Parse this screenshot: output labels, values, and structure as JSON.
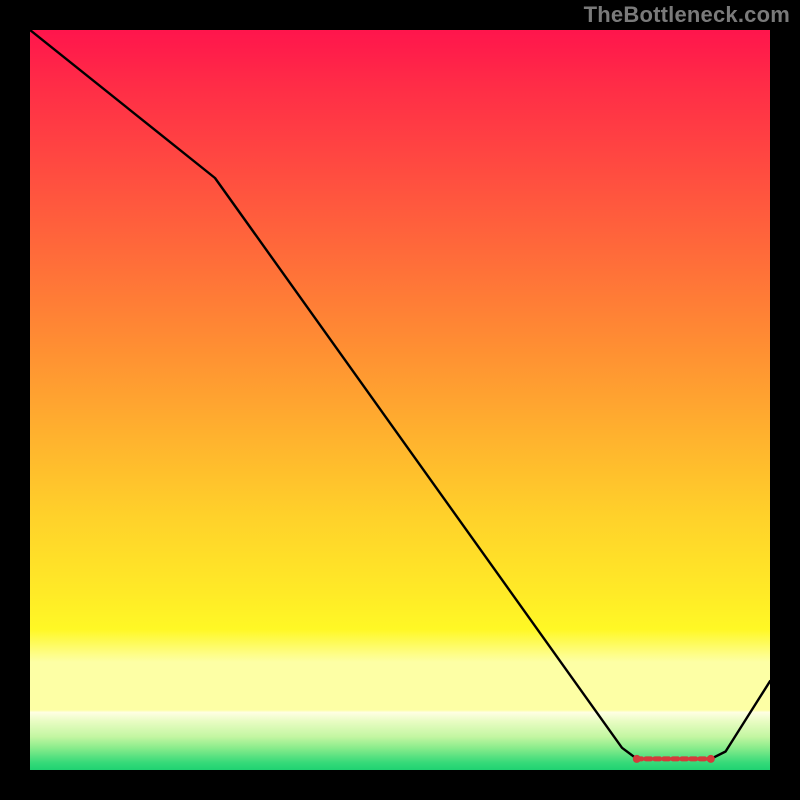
{
  "watermark": "TheBottleneck.com",
  "chart_data": {
    "type": "line",
    "title": "",
    "xlabel": "",
    "ylabel": "",
    "xlim": [
      0,
      100
    ],
    "ylim": [
      0,
      100
    ],
    "series": [
      {
        "name": "bottleneck-curve",
        "x": [
          0,
          25,
          80,
          82,
          92,
          94,
          100
        ],
        "values": [
          100,
          80,
          3,
          1.5,
          1.5,
          2.5,
          12
        ]
      }
    ],
    "optimal_zone": {
      "name": "sweet-spot-markers",
      "x": [
        82,
        84,
        86,
        88,
        90,
        92
      ],
      "values": [
        1.5,
        1.5,
        1.5,
        1.5,
        1.5,
        1.5
      ]
    },
    "gradient_stops": [
      {
        "pos": 0.0,
        "color": "#ff154c"
      },
      {
        "pos": 0.07,
        "color": "#ff2b47"
      },
      {
        "pos": 0.18,
        "color": "#ff4941"
      },
      {
        "pos": 0.3,
        "color": "#ff6a3a"
      },
      {
        "pos": 0.42,
        "color": "#ff8c33"
      },
      {
        "pos": 0.55,
        "color": "#ffb22e"
      },
      {
        "pos": 0.66,
        "color": "#ffd22a"
      },
      {
        "pos": 0.76,
        "color": "#ffea27"
      },
      {
        "pos": 0.81,
        "color": "#fff825"
      },
      {
        "pos": 0.855,
        "color": "#fdffa5"
      },
      {
        "pos": 0.919,
        "color": "#fdffa5"
      },
      {
        "pos": 0.922,
        "color": "#ffffe3"
      },
      {
        "pos": 0.935,
        "color": "#e7fcc1"
      },
      {
        "pos": 0.955,
        "color": "#c3f6a2"
      },
      {
        "pos": 0.97,
        "color": "#8aec8c"
      },
      {
        "pos": 0.99,
        "color": "#36da79"
      },
      {
        "pos": 1.0,
        "color": "#1fd272"
      }
    ]
  }
}
